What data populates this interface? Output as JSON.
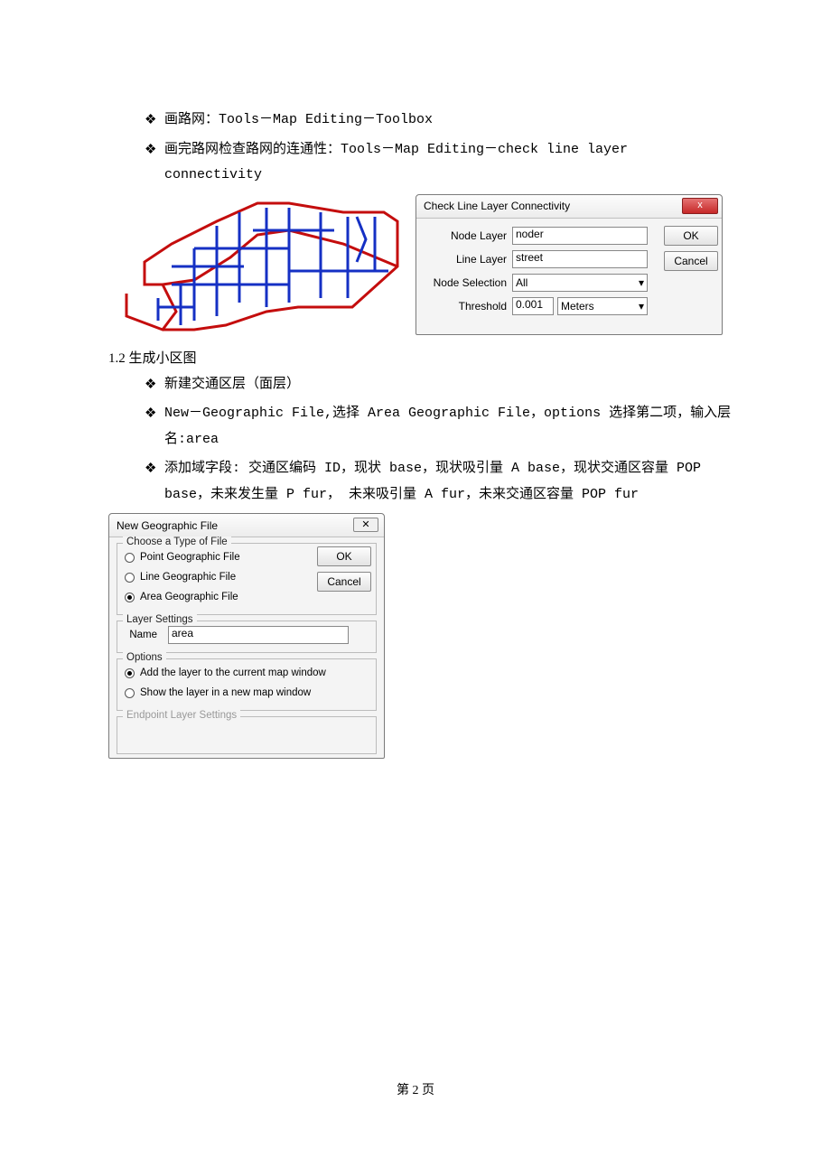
{
  "bullets1": {
    "b1": "画路网：Tools－Map Editing－Toolbox",
    "b2_a": "画完路网检查路网的连通性：Tools－Map Editing－check line layer",
    "b2_b": "connectivity"
  },
  "dlg_conn": {
    "title": "Check Line Layer Connectivity",
    "node_layer_label": "Node Layer",
    "node_layer_value": "noder",
    "line_layer_label": "Line Layer",
    "line_layer_value": "street",
    "node_sel_label": "Node Selection",
    "node_sel_value": "All",
    "threshold_label": "Threshold",
    "threshold_value": "0.001",
    "units_value": "Meters",
    "ok": "OK",
    "cancel": "Cancel",
    "close": "x"
  },
  "section12": "1.2 生成小区图",
  "bullets2": {
    "b1": "新建交通区层（面层）",
    "b2_a": "New－Geographic File,选择 Area Geographic File，options 选择第二项，输入层",
    "b2_b": "名:area",
    "b3_a": "添加域字段: 交通区编码 ID，现状 base，现状吸引量 A  base，现状交通区容量 POP",
    "b3_b": "base，未来发生量 P fur，  未来吸引量 A fur，未来交通区容量 POP fur"
  },
  "dlg_ngf": {
    "title": "New Geographic File",
    "close": "✕",
    "grp_type": "Choose a Type of File",
    "opt_point": "Point Geographic File",
    "opt_line": "Line Geographic File",
    "opt_area": "Area Geographic File",
    "ok": "OK",
    "cancel": "Cancel",
    "grp_layer": "Layer Settings",
    "name_label": "Name",
    "name_value": "area",
    "grp_options": "Options",
    "opt_add": "Add the layer to the current map window",
    "opt_show": "Show the layer in a new map window",
    "grp_endpoint": "Endpoint Layer Settings"
  },
  "footer": "第 2 页"
}
